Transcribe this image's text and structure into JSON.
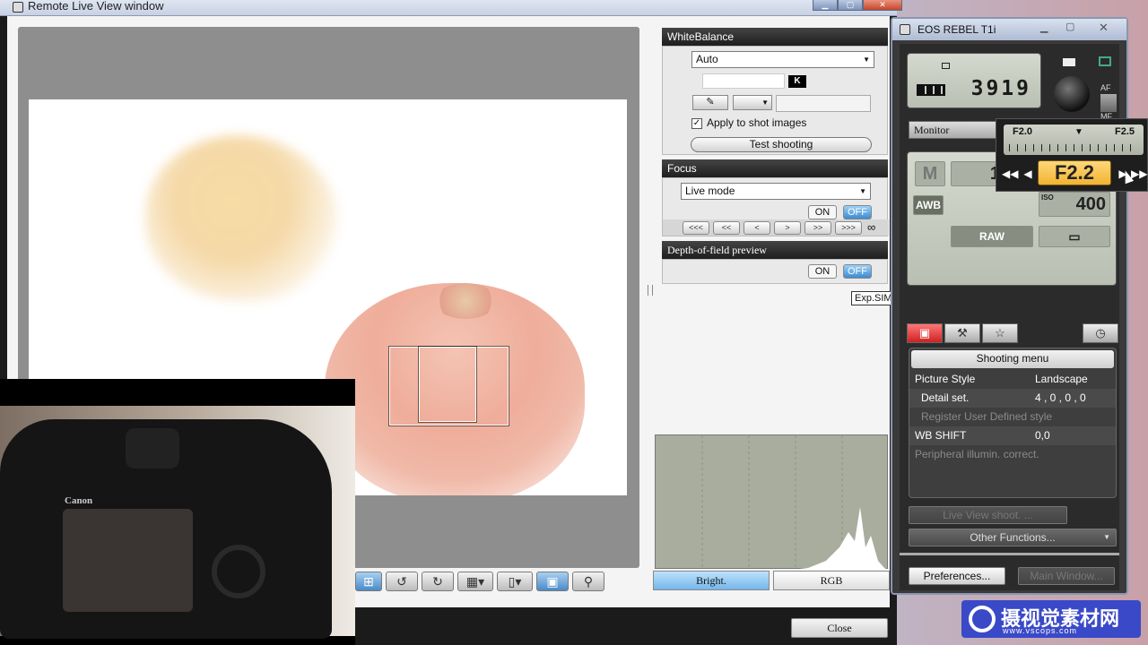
{
  "remote_live_view": {
    "title": "Remote Live View window",
    "close_label": "Close",
    "exp_sim": "Exp.SIM",
    "white_balance": {
      "header": "WhiteBalance",
      "mode": "Auto",
      "kelvin_unit": "K",
      "apply_label": "Apply to shot images",
      "apply_checked": true,
      "test_label": "Test shooting"
    },
    "focus": {
      "header": "Focus",
      "mode": "Live mode",
      "on_label": "ON",
      "off_label": "OFF",
      "steps": [
        "<<<",
        "<<",
        "<",
        ">",
        ">>",
        ">>>"
      ],
      "infinity": "∞"
    },
    "dof": {
      "header": "Depth-of-field preview",
      "on_label": "ON",
      "off_label": "OFF"
    },
    "histogram_tabs": [
      "Bright.",
      "RGB"
    ],
    "video_overlay": {
      "brand": "Canon"
    }
  },
  "eos_window": {
    "title": "EOS REBEL T1i",
    "shots_remaining": "3919",
    "monitor_label": "Monitor",
    "mode": "M",
    "wb": "AWB",
    "quality": "RAW",
    "iso_label": "ISO",
    "iso_value": "400",
    "shutter_partial": "1",
    "af_label": "AF",
    "mf_label": "MF",
    "aperture_popup": {
      "scale_left": "F2.0",
      "scale_right": "F2.5",
      "value": "F2.2"
    },
    "shooting_menu": {
      "header": "Shooting menu",
      "rows": [
        {
          "key": "Picture Style",
          "value": "Landscape",
          "dim": false,
          "indent": false
        },
        {
          "key": "Detail set.",
          "value": "4 , 0 , 0 , 0",
          "dim": false,
          "indent": true
        },
        {
          "key": "Register User Defined style",
          "value": "",
          "dim": true,
          "indent": true
        },
        {
          "key": "WB SHIFT",
          "value": "0,0",
          "dim": false,
          "indent": false
        },
        {
          "key": "Peripheral illumin. correct.",
          "value": "",
          "dim": true,
          "indent": false
        }
      ]
    },
    "live_view_label": "Live View shoot. ...",
    "other_functions_label": "Other Functions...",
    "preferences_label": "Preferences...",
    "main_window_label": "Main Window..."
  },
  "watermark": {
    "text": "摄视觉素材网",
    "url": "www.vscops.com"
  }
}
